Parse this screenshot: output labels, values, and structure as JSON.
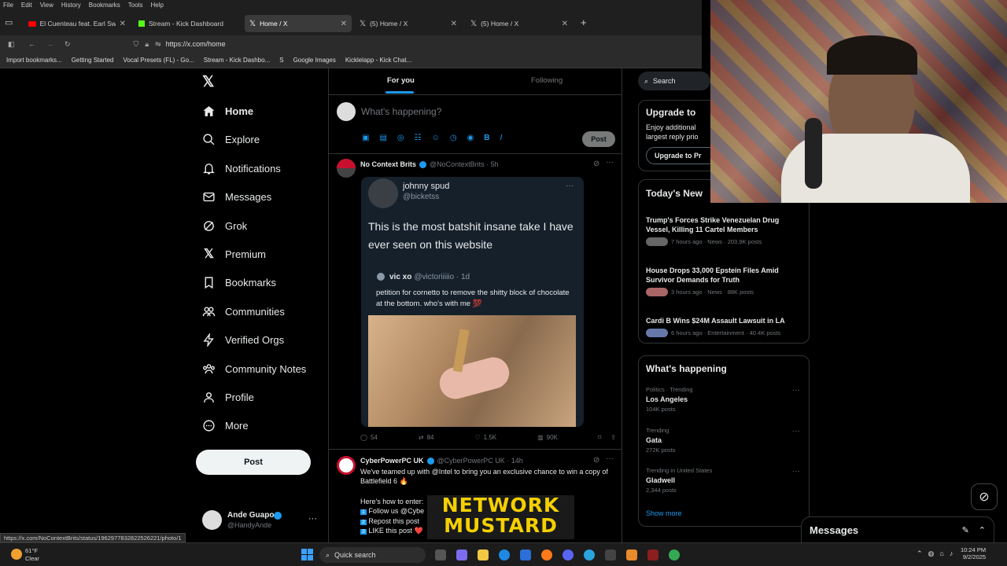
{
  "menu": [
    "File",
    "Edit",
    "View",
    "History",
    "Bookmarks",
    "Tools",
    "Help"
  ],
  "tabs": [
    {
      "label": "El Cuenteau feat. Earl Sweatshir"
    },
    {
      "label": "Stream - Kick Dashboard"
    },
    {
      "label": "Home / X"
    },
    {
      "label": "(5) Home / X"
    },
    {
      "label": "(5) Home / X"
    }
  ],
  "address": "https://x.com/home",
  "bookmarks": [
    "Import bookmarks...",
    "Getting Started",
    "Vocal Presets (FL) - Go...",
    "Stream - Kick Dashbo...",
    "S",
    "Google Images",
    "Kicklelapp - Kick Chat..."
  ],
  "nav": {
    "home": "Home",
    "explore": "Explore",
    "notifications": "Notifications",
    "messages": "Messages",
    "grok": "Grok",
    "premium": "Premium",
    "bookmarks": "Bookmarks",
    "communities": "Communities",
    "verified": "Verified Orgs",
    "notes": "Community Notes",
    "profile": "Profile",
    "more": "More",
    "post": "Post"
  },
  "account": {
    "name": "Ande Guapo",
    "handle": "@HandyAnde"
  },
  "feed_tabs": {
    "for_you": "For you",
    "following": "Following"
  },
  "composer": {
    "placeholder": "What's happening?",
    "post": "Post"
  },
  "tweet1": {
    "author": "No Context Brits",
    "handle": "@NoContextBrits · 5h",
    "quoted_name": "johnny spud",
    "quoted_handle": "@bicketss",
    "quoted_text": "This is the most batshit insane take I have ever seen on this website",
    "inner_name": "vic xo",
    "inner_handle": "@victoriiiiio · 1d",
    "inner_text": "petition for cornetto to remove the shitty block of chocolate at the bottom. who's with me 💯",
    "replies": "54",
    "retweets": "84",
    "likes": "1.5K",
    "views": "90K"
  },
  "tweet2": {
    "author": "CyberPowerPC UK",
    "handle": "@CyberPowerPC UK · 14h",
    "text": "We've teamed up with @Intel to bring you an exclusive chance to win a copy of Battlefield 6 🔥",
    "howto": "Here's how to enter:",
    "step1": "Follow us @Cybe",
    "step2": "Repost this post",
    "step3": "LIKE this post ❤️"
  },
  "overlay": {
    "line1": "NETWORK",
    "line2": "MUSTARD"
  },
  "search": {
    "placeholder": "Search"
  },
  "premium": {
    "title": "Upgrade to",
    "text": "Enjoy additional largest reply prio",
    "button": "Upgrade to Pr"
  },
  "news": {
    "title": "Today's New",
    "items": [
      {
        "title": "Trump's Forces Strike Venezuelan Drug Vessel, Killing 11 Cartel Members",
        "meta": "7 hours ago · News · 203.9K posts"
      },
      {
        "title": "House Drops 33,000 Epstein Files Amid Survivor Demands for Truth",
        "meta": "3 hours ago · News · 88K posts"
      },
      {
        "title": "Cardi B Wins $24M Assault Lawsuit in LA",
        "meta": "6 hours ago · Entertainment · 40.4K posts"
      }
    ]
  },
  "happening": {
    "title": "What's happening",
    "items": [
      {
        "context": "Politics · Trending",
        "name": "Los Angeles",
        "posts": "104K posts"
      },
      {
        "context": "Trending",
        "name": "Gata",
        "posts": "272K posts"
      },
      {
        "context": "Trending in United States",
        "name": "Gladwell",
        "posts": "2,344 posts"
      }
    ],
    "show_more": "Show more"
  },
  "messages_dock": "Messages",
  "status_url": "https://x.com/NoContextBrits/status/1962977832822526221/photo/1",
  "taskbar": {
    "weather_temp": "61°F",
    "weather_desc": "Clear",
    "search": "Quick search",
    "time": "10:24 PM",
    "date": "9/2/2025"
  }
}
